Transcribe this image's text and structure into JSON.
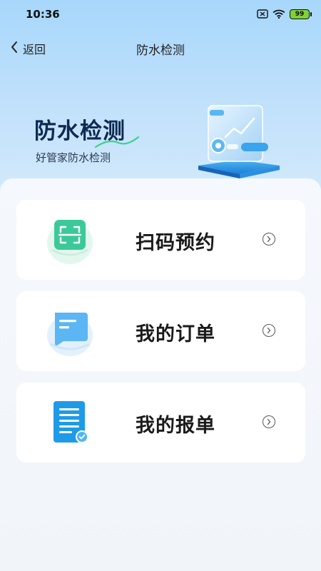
{
  "status_bar": {
    "time": "10:36",
    "battery_level": "99",
    "icons": [
      "sim-off-icon",
      "wifi-icon",
      "battery-icon"
    ]
  },
  "nav": {
    "back_label": "返回",
    "title": "防水检测"
  },
  "banner": {
    "title": "防水检测",
    "subtitle": "好管家防水检测"
  },
  "menu": {
    "items": [
      {
        "label": "扫码预约",
        "icon": "scan-icon"
      },
      {
        "label": "我的订单",
        "icon": "order-icon"
      },
      {
        "label": "我的报单",
        "icon": "report-icon"
      }
    ]
  },
  "colors": {
    "accent": "#1e9be8",
    "scan_green": "#3bc99a",
    "header_gradient_top": "#a7d7fb",
    "background": "#f3f7fb"
  }
}
